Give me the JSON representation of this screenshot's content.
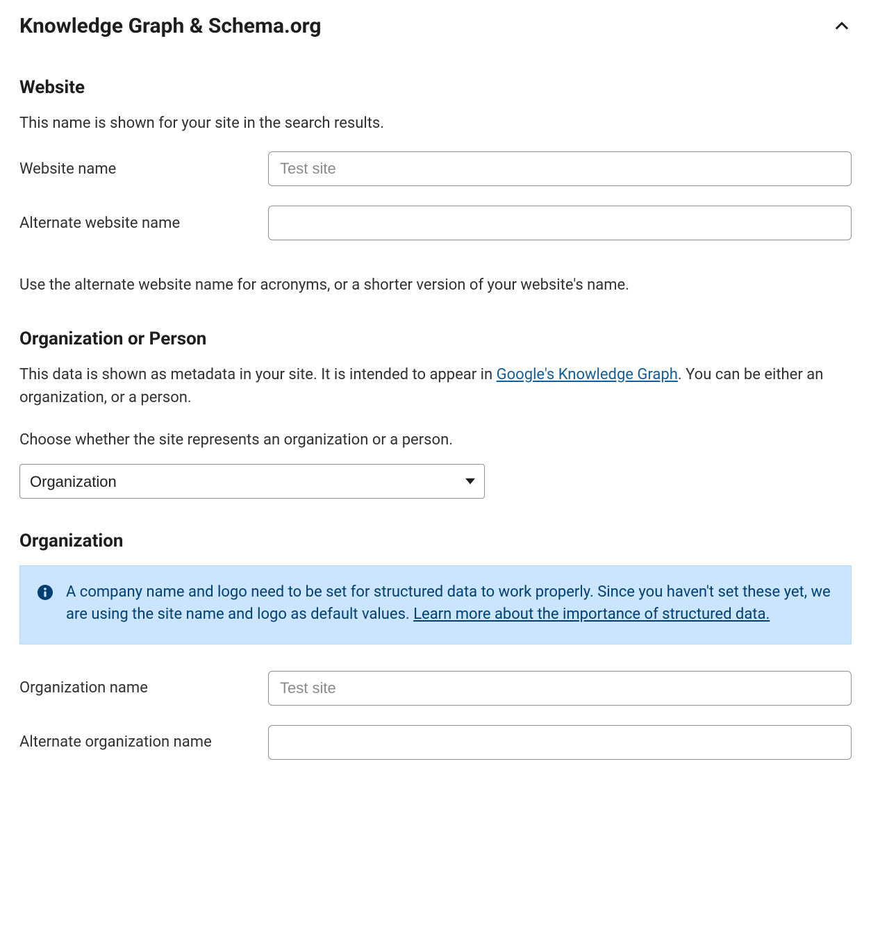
{
  "panel": {
    "title": "Knowledge Graph & Schema.org"
  },
  "website": {
    "heading": "Website",
    "desc": "This name is shown for your site in the search results.",
    "name_label": "Website name",
    "name_placeholder": "Test site",
    "alt_label": "Alternate website name",
    "alt_value": "",
    "alt_desc": "Use the alternate website name for acronyms, or a shorter version of your website's name."
  },
  "org_person": {
    "heading": "Organization or Person",
    "desc_before_link": "This data is shown as metadata in your site. It is intended to appear in ",
    "link_text": "Google's Knowledge Graph",
    "desc_after_link": ". You can be either an organization, or a person.",
    "choose_desc": "Choose whether the site represents an organization or a person.",
    "select_value": "Organization"
  },
  "organization": {
    "heading": "Organization",
    "alert_text": "A company name and logo need to be set for structured data to work properly. Since you haven't set these yet, we are using the site name and logo as default values. ",
    "alert_link": "Learn more about the importance of structured data.",
    "name_label": "Organization name",
    "name_placeholder": "Test site",
    "alt_label": "Alternate organization name",
    "alt_value": ""
  }
}
